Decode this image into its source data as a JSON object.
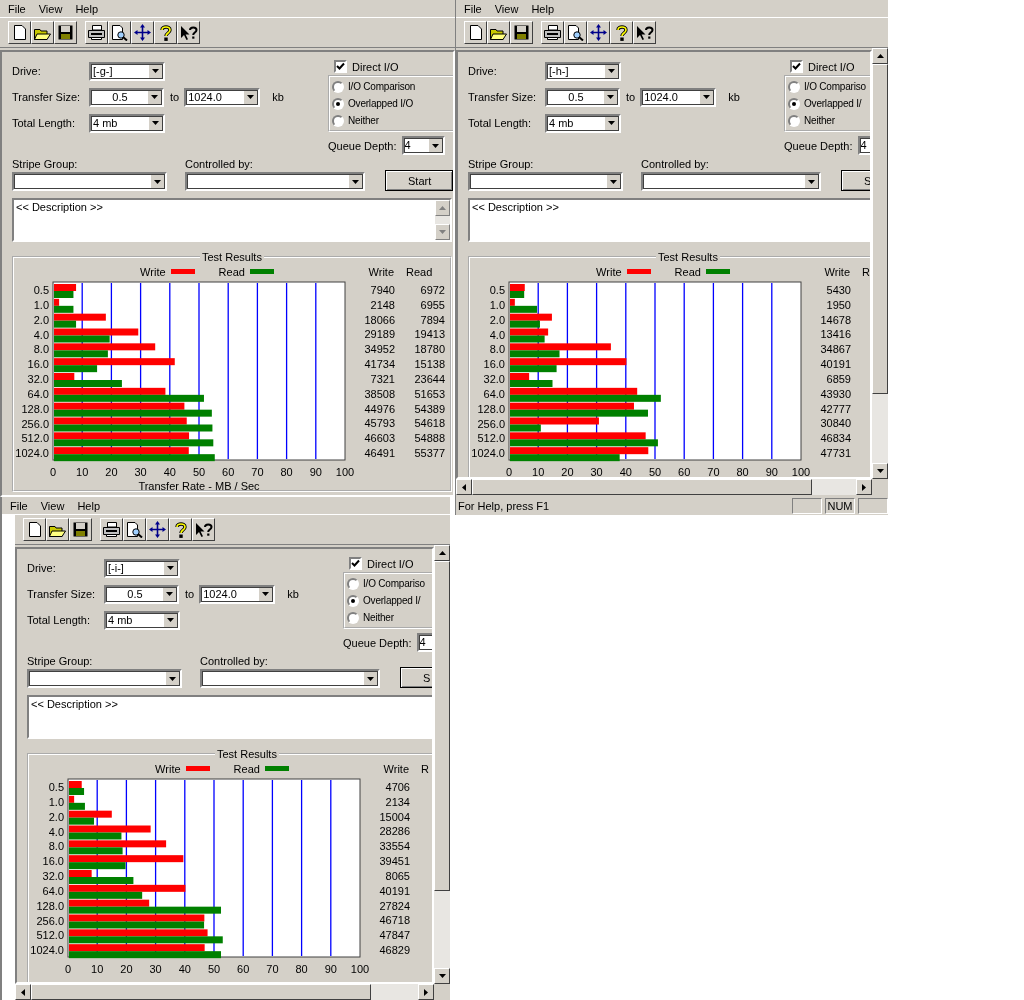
{
  "windows": [
    {
      "menu": [
        "File",
        "View",
        "Help"
      ],
      "form": {
        "drive_label": "Drive:",
        "drive": "[-g-]",
        "transfer_label": "Transfer Size:",
        "transfer_from": "0.5",
        "to_label": "to",
        "transfer_to": "1024.0",
        "unit": "kb",
        "length_label": "Total Length:",
        "total_length": "4 mb",
        "direct_io": {
          "label": "Direct I/O",
          "checked": true
        },
        "io_modes": [
          {
            "label": "I/O Comparison",
            "selected": false
          },
          {
            "label": "Overlapped I/O",
            "selected": true
          },
          {
            "label": "Neither",
            "selected": false
          }
        ],
        "queue_label": "Queue Depth:",
        "queue_depth": "4",
        "stripe_label": "Stripe Group:",
        "controlled_label": "Controlled by:",
        "start": "Start",
        "description": "<< Description >>"
      },
      "results": {
        "title": "Test Results",
        "chart_data": {
          "type": "bar",
          "orientation": "horizontal",
          "xlabel": "Transfer Rate - MB / Sec",
          "grid": true,
          "categories": [
            "0.5",
            "1.0",
            "2.0",
            "4.0",
            "8.0",
            "16.0",
            "32.0",
            "64.0",
            "128.0",
            "256.0",
            "512.0",
            "1024.0"
          ],
          "xlim": [
            0,
            100
          ],
          "xticks": [
            0,
            10,
            20,
            30,
            40,
            50,
            60,
            70,
            80,
            90,
            100
          ],
          "series": [
            {
              "name": "Write",
              "color": "#ff0000",
              "values": [
                7.9,
                2.1,
                18.1,
                29.2,
                35.0,
                41.7,
                7.3,
                38.5,
                45.0,
                45.8,
                46.6,
                46.5
              ]
            },
            {
              "name": "Read",
              "color": "#008000",
              "values": [
                7.0,
                7.0,
                7.9,
                19.4,
                18.8,
                15.1,
                23.6,
                51.7,
                54.4,
                54.6,
                54.9,
                55.4
              ]
            }
          ]
        },
        "table": [
          {
            "heading": "Write",
            "values": [
              "7940",
              "2148",
              "18066",
              "29189",
              "34952",
              "41734",
              "7321",
              "38508",
              "44976",
              "45793",
              "46603",
              "46491"
            ]
          },
          {
            "heading": "Read",
            "values": [
              "6972",
              "6955",
              "7894",
              "19413",
              "18780",
              "15138",
              "23644",
              "51653",
              "54389",
              "54618",
              "54888",
              "55377"
            ]
          }
        ]
      }
    },
    {
      "menu": [
        "File",
        "View",
        "Help"
      ],
      "form": {
        "drive_label": "Drive:",
        "drive": "[-h-]",
        "transfer_label": "Transfer Size:",
        "transfer_from": "0.5",
        "to_label": "to",
        "transfer_to": "1024.0",
        "unit": "kb",
        "length_label": "Total Length:",
        "total_length": "4 mb",
        "direct_io": {
          "label": "Direct I/O",
          "checked": true
        },
        "io_modes": [
          {
            "label": "I/O Compariso",
            "selected": false
          },
          {
            "label": "Overlapped I/",
            "selected": true
          },
          {
            "label": "Neither",
            "selected": false
          }
        ],
        "queue_label": "Queue Depth:",
        "queue_depth": "4",
        "stripe_label": "Stripe Group:",
        "controlled_label": "Controlled by:",
        "start": "S",
        "description": "<< Description >>"
      },
      "results": {
        "title": "Test Results",
        "chart_data": {
          "type": "bar",
          "orientation": "horizontal",
          "categories": [
            "0.5",
            "1.0",
            "2.0",
            "4.0",
            "8.0",
            "16.0",
            "32.0",
            "64.0",
            "128.0",
            "256.0",
            "512.0",
            "1024.0"
          ],
          "xlim": [
            0,
            100
          ],
          "xticks": [
            0,
            10,
            20,
            30,
            40,
            50,
            60,
            70,
            80,
            90,
            100
          ],
          "grid": true,
          "series": [
            {
              "name": "Write",
              "color": "#ff0000",
              "values": [
                5.4,
                2.0,
                14.7,
                13.4,
                34.9,
                40.2,
                6.9,
                43.9,
                42.8,
                30.8,
                46.8,
                47.7
              ]
            },
            {
              "name": "Read",
              "color": "#008000",
              "values": [
                5.2,
                9.6,
                10.6,
                12.2,
                17.3,
                16.3,
                14.9,
                52.0,
                47.6,
                10.9,
                51.0,
                37.9
              ]
            }
          ]
        },
        "table": [
          {
            "heading": "Write",
            "values": [
              "5430",
              "1950",
              "14678",
              "13416",
              "34867",
              "40191",
              "6859",
              "43930",
              "42777",
              "30840",
              "46834",
              "47731"
            ]
          },
          {
            "heading": "R"
          }
        ]
      },
      "status_bar": {
        "text": "For Help, press F1",
        "indicators": [
          "NUM"
        ]
      }
    },
    {
      "menu": [
        "File",
        "View",
        "Help"
      ],
      "form": {
        "drive_label": "Drive:",
        "drive": "[-i-]",
        "transfer_label": "Transfer Size:",
        "transfer_from": "0.5",
        "to_label": "to",
        "transfer_to": "1024.0",
        "unit": "kb",
        "length_label": "Total Length:",
        "total_length": "4 mb",
        "direct_io": {
          "label": "Direct I/O",
          "checked": true
        },
        "io_modes": [
          {
            "label": "I/O Compariso",
            "selected": false
          },
          {
            "label": "Overlapped I/",
            "selected": true
          },
          {
            "label": "Neither",
            "selected": false
          }
        ],
        "queue_label": "Queue Depth:",
        "queue_depth": "4",
        "stripe_label": "Stripe Group:",
        "controlled_label": "Controlled by:",
        "start": "S",
        "description": "<< Description >>"
      },
      "results": {
        "title": "Test Results",
        "chart_data": {
          "type": "bar",
          "orientation": "horizontal",
          "categories": [
            "0.5",
            "1.0",
            "2.0",
            "4.0",
            "8.0",
            "16.0",
            "32.0",
            "64.0",
            "128.0",
            "256.0",
            "512.0",
            "1024.0"
          ],
          "xlim": [
            0,
            100
          ],
          "xticks": [
            0,
            10,
            20,
            30,
            40,
            50,
            60,
            70,
            80,
            90,
            100
          ],
          "grid": true,
          "series": [
            {
              "name": "Write",
              "color": "#ff0000",
              "values": [
                4.7,
                2.1,
                15.0,
                28.3,
                33.6,
                39.5,
                8.1,
                40.2,
                27.8,
                46.7,
                47.8,
                46.8
              ]
            },
            {
              "name": "Read",
              "color": "#008000",
              "values": [
                5.5,
                5.8,
                8.9,
                18.3,
                18.7,
                19.7,
                22.4,
                25.4,
                52.4,
                46.6,
                53.0,
                52.4
              ]
            }
          ]
        },
        "table": [
          {
            "heading": "Write",
            "values": [
              "4706",
              "2134",
              "15004",
              "28286",
              "33554",
              "39451",
              "8065",
              "40191",
              "27824",
              "46718",
              "47847",
              "46829"
            ]
          },
          {
            "heading": "R"
          }
        ]
      }
    }
  ]
}
